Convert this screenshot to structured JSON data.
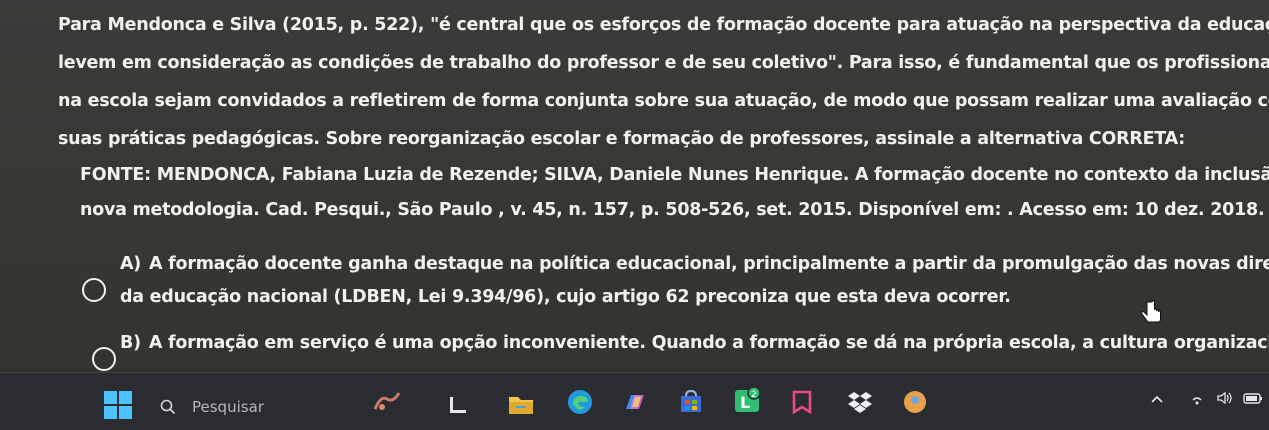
{
  "question": {
    "lines": [
      "Para Mendonca e Silva (2015, p. 522), \"é central que os esforços de formação docente para atuação na perspectiva da educação inclusiva",
      "levem em consideração as condições de trabalho do professor e de seu coletivo\". Para isso, é fundamental que os profissionais envolvido",
      "na escola sejam convidados a refletirem de forma conjunta sobre sua atuação, de modo que possam realizar uma avaliação constante de",
      "suas práticas pedagógicas. Sobre reorganização escolar e formação de professores, assinale a alternativa CORRETA:"
    ]
  },
  "source": {
    "lines": [
      "FONTE: MENDONCA, Fabiana Luzia de Rezende; SILVA, Daniele Nunes Henrique. A formação docente no contexto da inclusão: para uma",
      "nova metodologia. Cad. Pesqui., São Paulo , v. 45, n. 157, p. 508-526, set. 2015.  Disponível em: . Acesso em: 10 dez. 2018."
    ]
  },
  "options": [
    {
      "letter": "A)",
      "lines": [
        "A formação docente ganha destaque na política educacional, principalmente a partir da promulgação das novas diretrizes e bases",
        "da educação nacional (LDBEN, Lei 9.394/96), cujo artigo 62 preconiza que esta deva ocorrer."
      ]
    },
    {
      "letter": "B)",
      "lines": [
        "A formação em serviço é uma opção inconveniente. Quando a formação se dá na própria escola, a cultura organizacional impede o"
      ]
    }
  ],
  "taskbar": {
    "search_placeholder": "Pesquisar",
    "apps": [
      "widgets-icon",
      "file-explorer-icon",
      "folder-icon",
      "edge-icon",
      "copilot-icon",
      "store-icon",
      "lingo-app-icon",
      "bookmark-app-icon",
      "dropbox-icon",
      "generic-app-icon"
    ],
    "badge": "2"
  },
  "colors": {
    "background": "#3a3937",
    "text": "#f3f1ee",
    "taskbar": "#2b2c31",
    "accent": "#4cc2ff"
  }
}
